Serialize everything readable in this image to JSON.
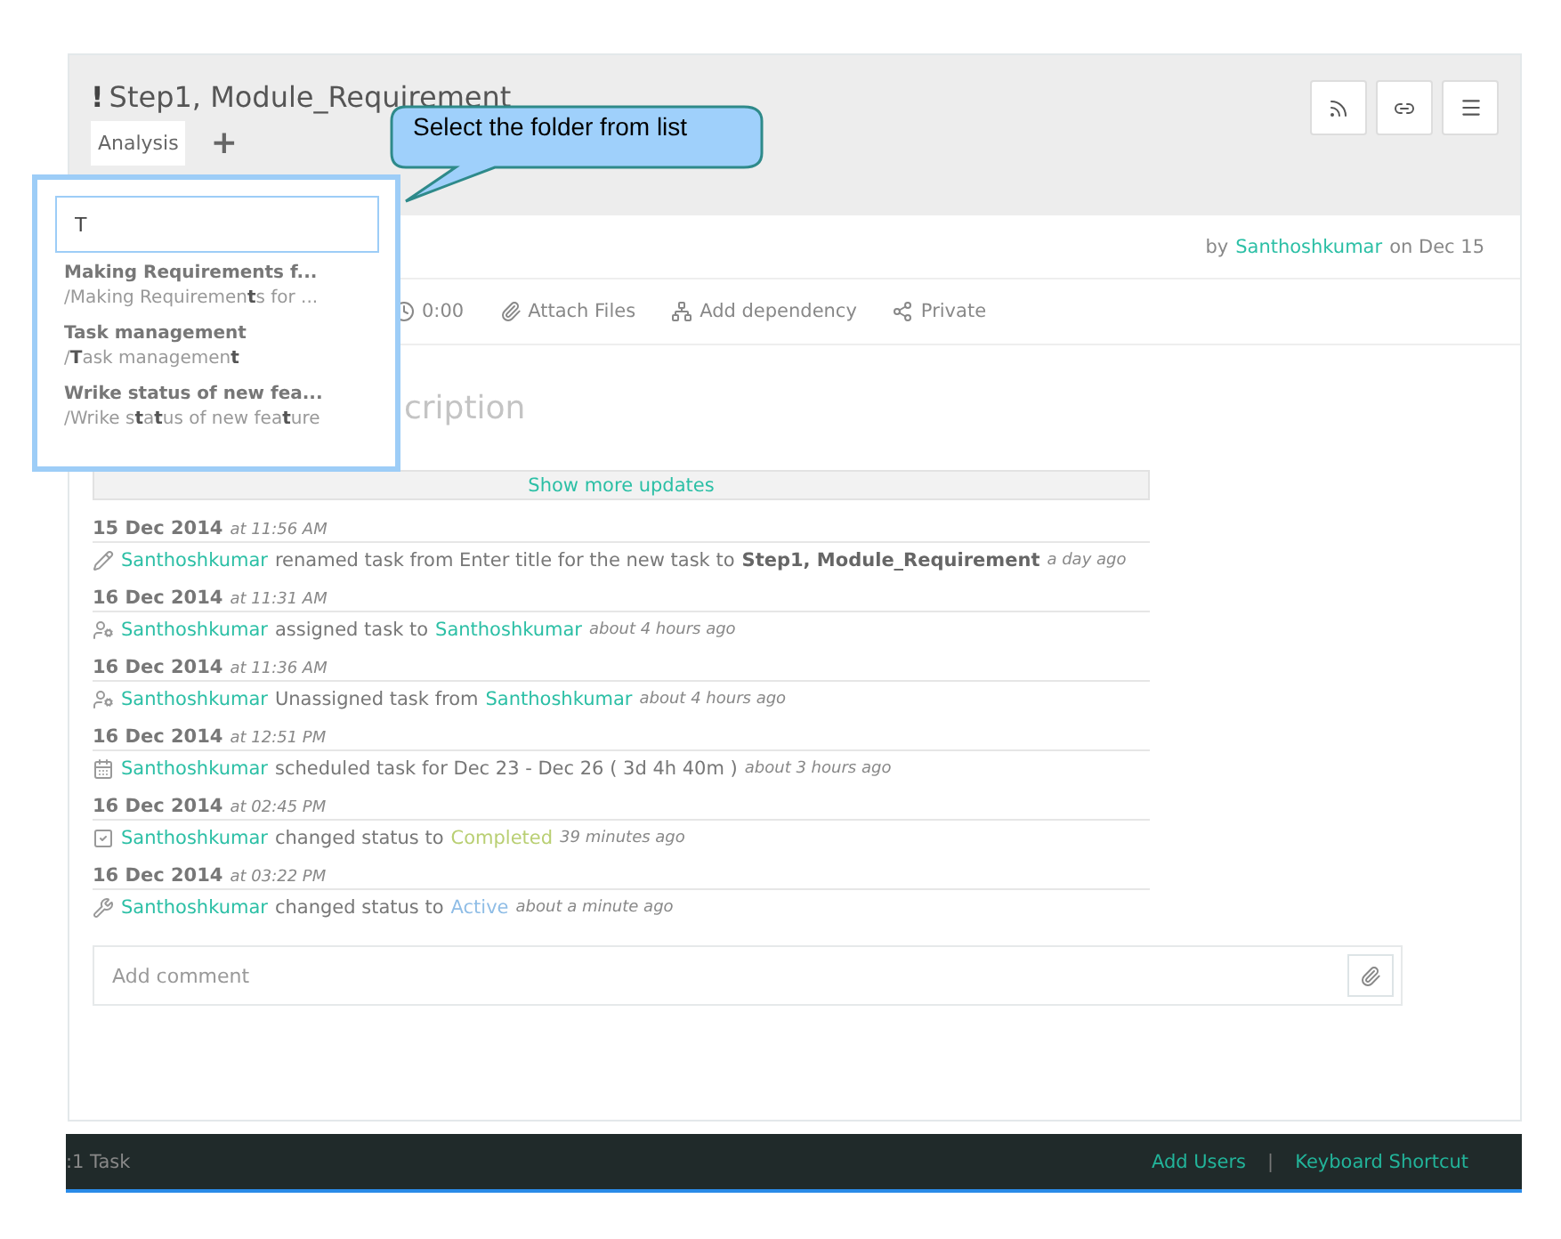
{
  "task": {
    "title": "Step1, Module_Requirement",
    "priority_mark": "!",
    "tabs": [
      {
        "label": "Analysis",
        "selected": true
      }
    ],
    "add_tab": "+"
  },
  "author": {
    "prefix": "by",
    "name": "Santhoshkumar",
    "suffix": "on Dec 15"
  },
  "toolbar": [
    {
      "kind": "clock",
      "label": "0:00"
    },
    {
      "kind": "attach",
      "label": "Attach Files"
    },
    {
      "kind": "dependency",
      "label": "Add dependency"
    },
    {
      "kind": "share",
      "label": "Private"
    }
  ],
  "description": {
    "placeholder": "cription"
  },
  "show_more": "Show more updates",
  "updates": [
    {
      "date": "15 Dec 2014",
      "time": "at 11:56 AM",
      "kind": "pencil",
      "ago": "a day ago",
      "parts": [
        {
          "kind": "user",
          "text": "Santhoshkumar"
        },
        {
          "kind": "text",
          "text": "renamed task from Enter title for the new task to"
        },
        {
          "kind": "strong",
          "text": "Step1, Module_Requirement"
        }
      ]
    },
    {
      "date": "16 Dec 2014",
      "time": "at 11:31 AM",
      "kind": "user",
      "ago": "about 4 hours ago",
      "parts": [
        {
          "kind": "user",
          "text": "Santhoshkumar"
        },
        {
          "kind": "text",
          "text": "assigned task to"
        },
        {
          "kind": "user",
          "text": "Santhoshkumar"
        }
      ]
    },
    {
      "date": "16 Dec 2014",
      "time": "at 11:36 AM",
      "kind": "user",
      "ago": "about 4 hours ago",
      "parts": [
        {
          "kind": "user",
          "text": "Santhoshkumar"
        },
        {
          "kind": "text",
          "text": "Unassigned task from"
        },
        {
          "kind": "user",
          "text": "Santhoshkumar"
        }
      ]
    },
    {
      "date": "16 Dec 2014",
      "time": "at 12:51 PM",
      "kind": "calendar",
      "ago": "about 3 hours ago",
      "parts": [
        {
          "kind": "user",
          "text": "Santhoshkumar"
        },
        {
          "kind": "text",
          "text": "scheduled task for Dec 23 - Dec 26 ( 3d 4h 40m )"
        }
      ]
    },
    {
      "date": "16 Dec 2014",
      "time": "at 02:45 PM",
      "kind": "check",
      "ago": "39 minutes ago",
      "parts": [
        {
          "kind": "user",
          "text": "Santhoshkumar"
        },
        {
          "kind": "text",
          "text": "changed status to"
        },
        {
          "kind": "status",
          "text": "Completed",
          "color": "#b9cf73"
        }
      ]
    },
    {
      "date": "16 Dec 2014",
      "time": "at 03:22 PM",
      "kind": "wrench",
      "ago": "about a minute ago",
      "parts": [
        {
          "kind": "user",
          "text": "Santhoshkumar"
        },
        {
          "kind": "text",
          "text": "changed status to"
        },
        {
          "kind": "status",
          "text": "Active",
          "color": "#8fbde6"
        }
      ]
    }
  ],
  "comment": {
    "placeholder": "Add comment"
  },
  "footer": {
    "count": ":1 Task",
    "links": [
      "Add Users",
      "Keyboard Shortcut"
    ],
    "separator": "|"
  },
  "folder_picker": {
    "value": "T",
    "results": [
      {
        "title": "Making Requirements f...",
        "path": "/Making Requiremen**t**s for ..."
      },
      {
        "title": "Task management",
        "path": "/**T**ask managemen**t**"
      },
      {
        "title": "Wrike status of new fea...",
        "path": "/Wrike s**t**a**t**us of new fea**t**ure"
      }
    ]
  },
  "callout": {
    "text": "Select the folder from list"
  }
}
